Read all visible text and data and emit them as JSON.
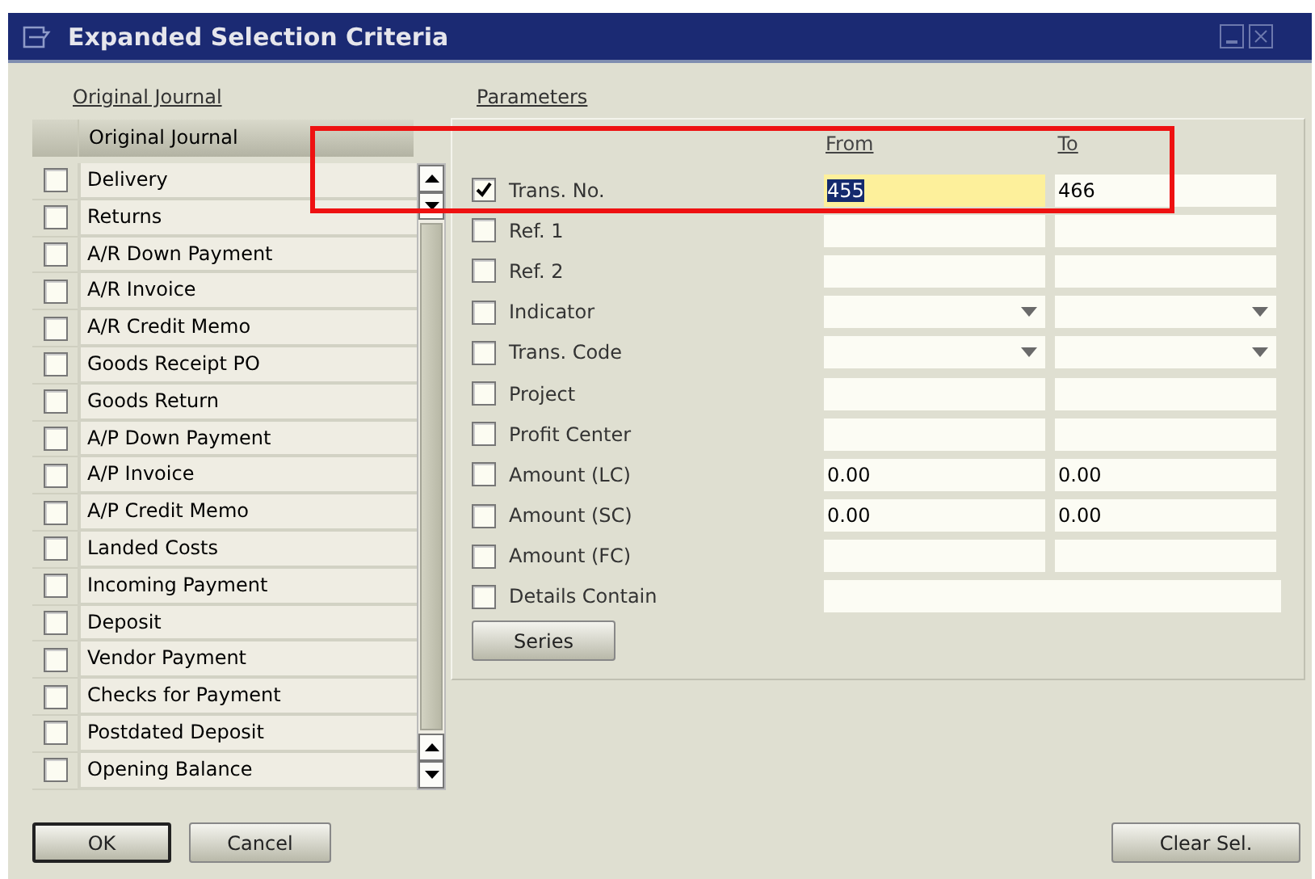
{
  "window": {
    "title": "Expanded Selection Criteria"
  },
  "journal": {
    "label": "Original Journal",
    "column": "Original Journal",
    "rows": [
      {
        "name": "Delivery",
        "checked": false
      },
      {
        "name": "Returns",
        "checked": false
      },
      {
        "name": "A/R Down Payment",
        "checked": false
      },
      {
        "name": "A/R Invoice",
        "checked": false
      },
      {
        "name": "A/R Credit Memo",
        "checked": false
      },
      {
        "name": "Goods Receipt PO",
        "checked": false
      },
      {
        "name": "Goods Return",
        "checked": false
      },
      {
        "name": "A/P Down Payment",
        "checked": false
      },
      {
        "name": "A/P Invoice",
        "checked": false
      },
      {
        "name": "A/P Credit Memo",
        "checked": false
      },
      {
        "name": "Landed Costs",
        "checked": false
      },
      {
        "name": "Incoming Payment",
        "checked": false
      },
      {
        "name": "Deposit",
        "checked": false
      },
      {
        "name": "Vendor Payment",
        "checked": false
      },
      {
        "name": "Checks for Payment",
        "checked": false
      },
      {
        "name": "Postdated Deposit",
        "checked": false
      },
      {
        "name": "Opening Balance",
        "checked": false
      }
    ]
  },
  "parameters": {
    "label": "Parameters",
    "from_heading": "From",
    "to_heading": "To",
    "rows": [
      {
        "label": "Trans. No.",
        "checked": true,
        "kind": "range",
        "fields": [
          {
            "value": "455",
            "focused": true
          },
          {
            "value": "466",
            "focused": false
          }
        ]
      },
      {
        "label": "Ref. 1",
        "checked": false,
        "kind": "range",
        "fields": [
          {
            "focused": false
          },
          {
            "focused": false
          }
        ]
      },
      {
        "label": "Ref. 2",
        "checked": false,
        "kind": "range",
        "fields": [
          {
            "focused": false
          },
          {
            "focused": false
          }
        ]
      },
      {
        "label": "Indicator",
        "checked": false,
        "kind": "dropdown",
        "fields": [
          {
            "focused": false
          },
          {
            "focused": false
          }
        ]
      },
      {
        "label": "Trans. Code",
        "checked": false,
        "kind": "dropdown",
        "fields": [
          {
            "focused": false
          },
          {
            "focused": false
          }
        ]
      },
      {
        "label": "Project",
        "checked": false,
        "kind": "range",
        "fields": [
          {
            "focused": false
          },
          {
            "focused": false
          }
        ]
      },
      {
        "label": "Profit Center",
        "checked": false,
        "kind": "range",
        "fields": [
          {
            "focused": false
          },
          {
            "focused": false
          }
        ]
      },
      {
        "label": "Amount (LC)",
        "checked": false,
        "kind": "range",
        "fields": [
          {
            "value": "0.00",
            "focused": false
          },
          {
            "value": "0.00",
            "focused": false
          }
        ]
      },
      {
        "label": "Amount (SC)",
        "checked": false,
        "kind": "range",
        "fields": [
          {
            "value": "0.00",
            "focused": false
          },
          {
            "value": "0.00",
            "focused": false
          }
        ]
      },
      {
        "label": "Amount (FC)",
        "checked": false,
        "kind": "range",
        "fields": [
          {
            "focused": false
          },
          {
            "focused": false
          }
        ]
      },
      {
        "label": "Details Contain",
        "checked": false,
        "kind": "single",
        "fields": [
          {
            "focused": false
          }
        ]
      }
    ],
    "series_button": "Series"
  },
  "buttons": {
    "ok": "OK",
    "cancel": "Cancel",
    "clear": "Clear Sel."
  },
  "annotation": {
    "kind": "highlight-box"
  }
}
